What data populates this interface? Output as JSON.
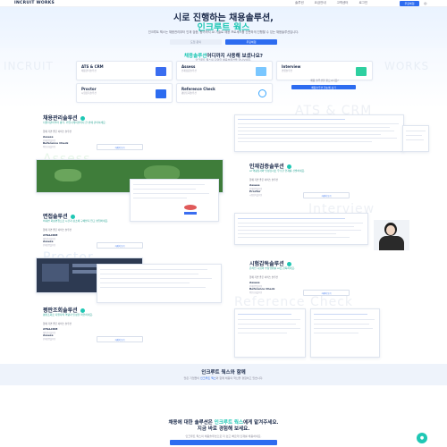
{
  "header": {
    "logo": "INCRUIT WORKS",
    "nav": [
      "솔루션",
      "요금안내",
      "고객센터",
      "로그인"
    ],
    "cta": "무료체험"
  },
  "hero": {
    "title1": "시로 진행하는 채용솔루션,",
    "title2": "인크루트 웍스",
    "desc": "인크루트 웍스는 채용관리부터 인재 검증, 평가까지 AI 기술로 채용 프로세스를 간편하게 진행할 수 있는 채용솔루션입니다.",
    "btn1": "도입 문의",
    "btn2": "무료체험"
  },
  "solutions": {
    "title_hl": "채용솔루션",
    "title_rest": "어디까지 사용해 보셨나요?",
    "sub": "인크루트 웍스의 다양한 채용솔루션을 만나보세요.",
    "cards": [
      {
        "title": "ATS & CRM",
        "sub": "채용관리솔루션",
        "color": "#3a6df0"
      },
      {
        "title": "Assess",
        "sub": "인재검증솔루션",
        "color": "#7ac7ff"
      },
      {
        "title": "Interview",
        "sub": "면접솔루션",
        "color": "#2fd0a0"
      },
      {
        "title": "Proctor",
        "sub": "시험감독솔루션",
        "color": "#2d6cf0"
      },
      {
        "title": "Reference Check",
        "sub": "평판조회솔루션",
        "color": "#3aa7ff"
      }
    ],
    "side_text": "채용 솔루션을 찾으시나요?",
    "side_btn": "채용솔루션 한눈에 보기"
  },
  "sections": [
    {
      "title": "채용관리솔루션",
      "desc": "지원자관리부터 평가, 커뮤니케이션까지 한 번에 관리하세요.",
      "label": "함께 가면 좋은 서비스 솔루션",
      "items": [
        {
          "name": "Assess",
          "sub": "인재검증솔루션"
        },
        {
          "name": "Reference Check",
          "sub": "평판조회솔루션"
        }
      ],
      "link": "자세히 보기"
    },
    {
      "title": "인재검증솔루션",
      "desc": "AI 역량검사와 인성검사로 우수한 인재를 선발하세요.",
      "label": "함께 가면 좋은 서비스 솔루션",
      "items": [
        {
          "name": "Assess",
          "sub": "인재검증솔루션"
        },
        {
          "name": "Proctor",
          "sub": "시험감독솔루션"
        }
      ],
      "link": "자세히 보기"
    },
    {
      "title": "면접솔루션",
      "desc": "비대면 화상면접으로 시간과 장소에 구애받지 않고 면접하세요.",
      "label": "함께 가면 좋은 서비스 솔루션",
      "items": [
        {
          "name": "ATS&CRM",
          "sub": "채용관리솔루션"
        },
        {
          "name": "Assess",
          "sub": "인재검증솔루션"
        }
      ],
      "link": "자세히 보기"
    },
    {
      "title": "시험감독솔루션",
      "desc": "온라인 시험의 부정행위를 AI로 감독하세요.",
      "label": "함께 가면 좋은 서비스 솔루션",
      "items": [
        {
          "name": "Assess",
          "sub": "인재검증솔루션"
        },
        {
          "name": "Reference Check",
          "sub": "평판조회솔루션"
        }
      ],
      "link": "자세히 보기"
    },
    {
      "title": "평판조회솔루션",
      "desc": "평판조회로 지원자의 역량과 인성을 확인하세요.",
      "label": "함께 가면 좋은 서비스 솔루션",
      "items": [
        {
          "name": "ATS&CRM",
          "sub": "채용관리솔루션"
        },
        {
          "name": "Assess",
          "sub": "인재검증솔루션"
        }
      ],
      "link": "자세히 보기"
    }
  ],
  "watermarks": [
    "ATS & CRM",
    "Assess",
    "Interview",
    "Proctor",
    "Reference Check"
  ],
  "band": {
    "title": "인크루트 웍스와 함께",
    "sub_pre": "많은 기업들이",
    "sub_hl": "인크루트 웍스",
    "sub_post": "와 함께 채용의 혁신을 경험하고 있습니다."
  },
  "cta": {
    "line1_pre": "채용에 대한 솔루션은 ",
    "line1_hl": "인크루트 웍스",
    "line1_post": "에게 맡겨주세요.",
    "line2": "지금 바로 경험해 보세요.",
    "sub": "인크루트 웍스의 채용솔루션으로 더 쉽고 빠르게 인재를 채용하세요."
  }
}
